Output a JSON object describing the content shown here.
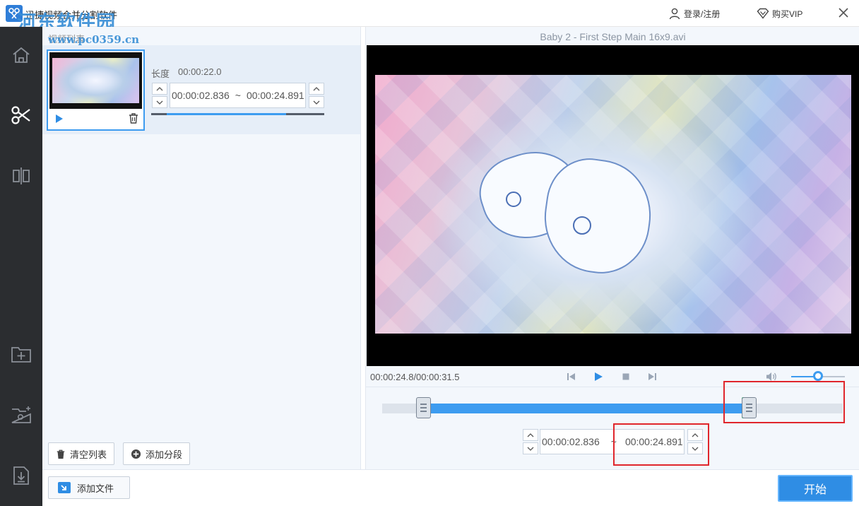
{
  "app": {
    "title": "迅捷视频合并分割软件",
    "watermark_main": "河东软件园",
    "watermark_sub": "www.pc0359.cn"
  },
  "titlebar": {
    "login_label": "登录/注册",
    "vip_label": "购买VIP",
    "icons": [
      "user-icon",
      "diamond-icon",
      "close-icon"
    ]
  },
  "sidebar": {
    "items": [
      {
        "icon": "home-icon",
        "active": false
      },
      {
        "icon": "scissors-icon",
        "active": true
      },
      {
        "icon": "split-icon",
        "active": false
      },
      {
        "icon": "add-folder-icon",
        "active": false
      },
      {
        "icon": "folder-settings-icon",
        "active": false
      },
      {
        "icon": "download-file-icon",
        "active": false
      }
    ]
  },
  "video_list": {
    "header": "视频列表",
    "item": {
      "length_label": "长度",
      "length_value": "00:00:22.0",
      "start_time": "00:00:02.836",
      "separator": "~",
      "end_time": "00:00:24.891",
      "range_fraction": [
        0.09,
        0.78
      ]
    },
    "clear_button": "清空列表",
    "add_segment_button": "添加分段"
  },
  "player": {
    "file_name": "Baby 2 - First Step Main 16x9.avi",
    "time_readout": "00:00:24.8/00:00:31.5",
    "volume_fraction": 0.5
  },
  "trim": {
    "start_time": "00:00:02.836",
    "separator": "~",
    "end_time": "00:00:24.891",
    "start_fraction": 0.09,
    "end_fraction": 0.79
  },
  "bottom": {
    "add_file_button": "添加文件",
    "start_button": "开始"
  },
  "colors": {
    "accent": "#3d9cf0",
    "sidebar": "#2b2d30",
    "highlight": "#e0262c",
    "handle_mark": "#2bb56a"
  }
}
